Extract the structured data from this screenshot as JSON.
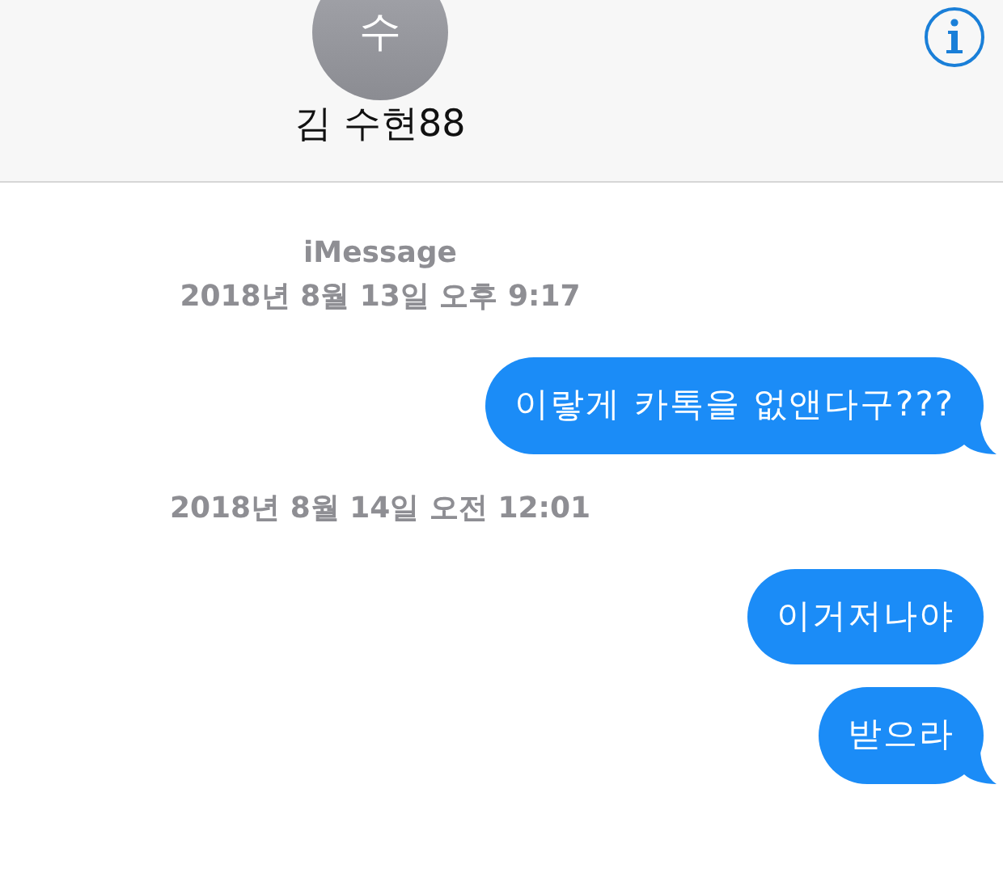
{
  "header": {
    "avatar_initial": "수",
    "contact_name": "김 수현88"
  },
  "conversation": [
    {
      "kind": "timestamp",
      "service": "iMessage",
      "text": "2018년 8월 13일 오후 9:17"
    },
    {
      "kind": "message",
      "text": "이랗게 카톡을 없앤다구???",
      "tail": true
    },
    {
      "kind": "timestamp",
      "text": "2018년 8월 14일 오전 12:01"
    },
    {
      "kind": "message",
      "text": "이거저나야",
      "tail": false
    },
    {
      "kind": "message",
      "text": "받으라",
      "tail": true
    }
  ]
}
